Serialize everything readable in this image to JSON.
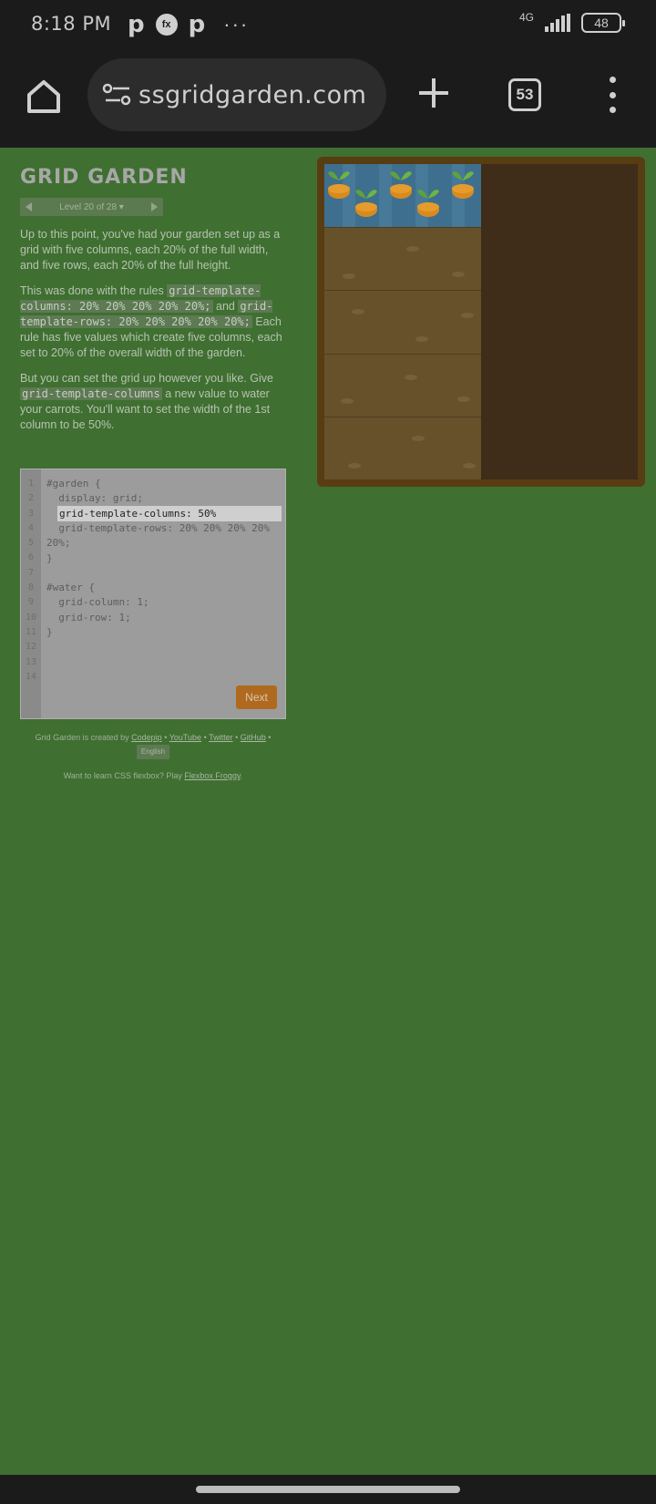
{
  "status_bar": {
    "time": "8:18 PM",
    "network": "4G",
    "battery": "48"
  },
  "browser": {
    "url": "ssgridgarden.com",
    "tab_count": "53"
  },
  "game": {
    "title": "GRID GARDEN",
    "level_label": "Level 20 of 28 ▾",
    "instructions": {
      "p1": "Up to this point, you've had your garden set up as a grid with five columns, each 20% of the full width, and five rows, each 20% of the full height.",
      "p2_a": "This was done with the rules ",
      "p2_code1": "grid-template-columns: 20% 20% 20% 20% 20%;",
      "p2_b": " and ",
      "p2_code2": "grid-template-rows: 20% 20% 20% 20% 20%;",
      "p2_c": " Each rule has five values which create five columns, each set to 20% of the overall width of the garden.",
      "p3_a": "But you can set the grid up however you like. Give ",
      "p3_code": "grid-template-columns",
      "p3_b": " a new value to water your carrots. You'll want to set the width of the 1st column to be 50%."
    },
    "editor": {
      "line_numbers": "1\n2\n3\n4\n5\n6\n7\n8\n9\n10\n11\n12\n13\n14",
      "code_before": "#garden {\n  display: grid;",
      "input_value": "grid-template-columns: 50%",
      "code_after": "  grid-template-rows: 20% 20% 20% 20%\n20%;\n}\n\n#water {\n  grid-column: 1;\n  grid-row: 1;\n}",
      "next_label": "Next"
    },
    "credits": {
      "prefix": "Grid Garden is created by ",
      "codepip": "Codepip",
      "youtube": "YouTube",
      "twitter": "Twitter",
      "github": "GitHub",
      "separator": " • ",
      "language": "English"
    },
    "froggy": {
      "text": "Want to learn CSS flexbox? Play ",
      "link": "Flexbox Froggy",
      "suffix": "."
    }
  },
  "colors": {
    "page_bg": "#3f6f31",
    "water": "#3e6f8e",
    "soil": "#66512b",
    "next_button": "#b06a1f"
  }
}
